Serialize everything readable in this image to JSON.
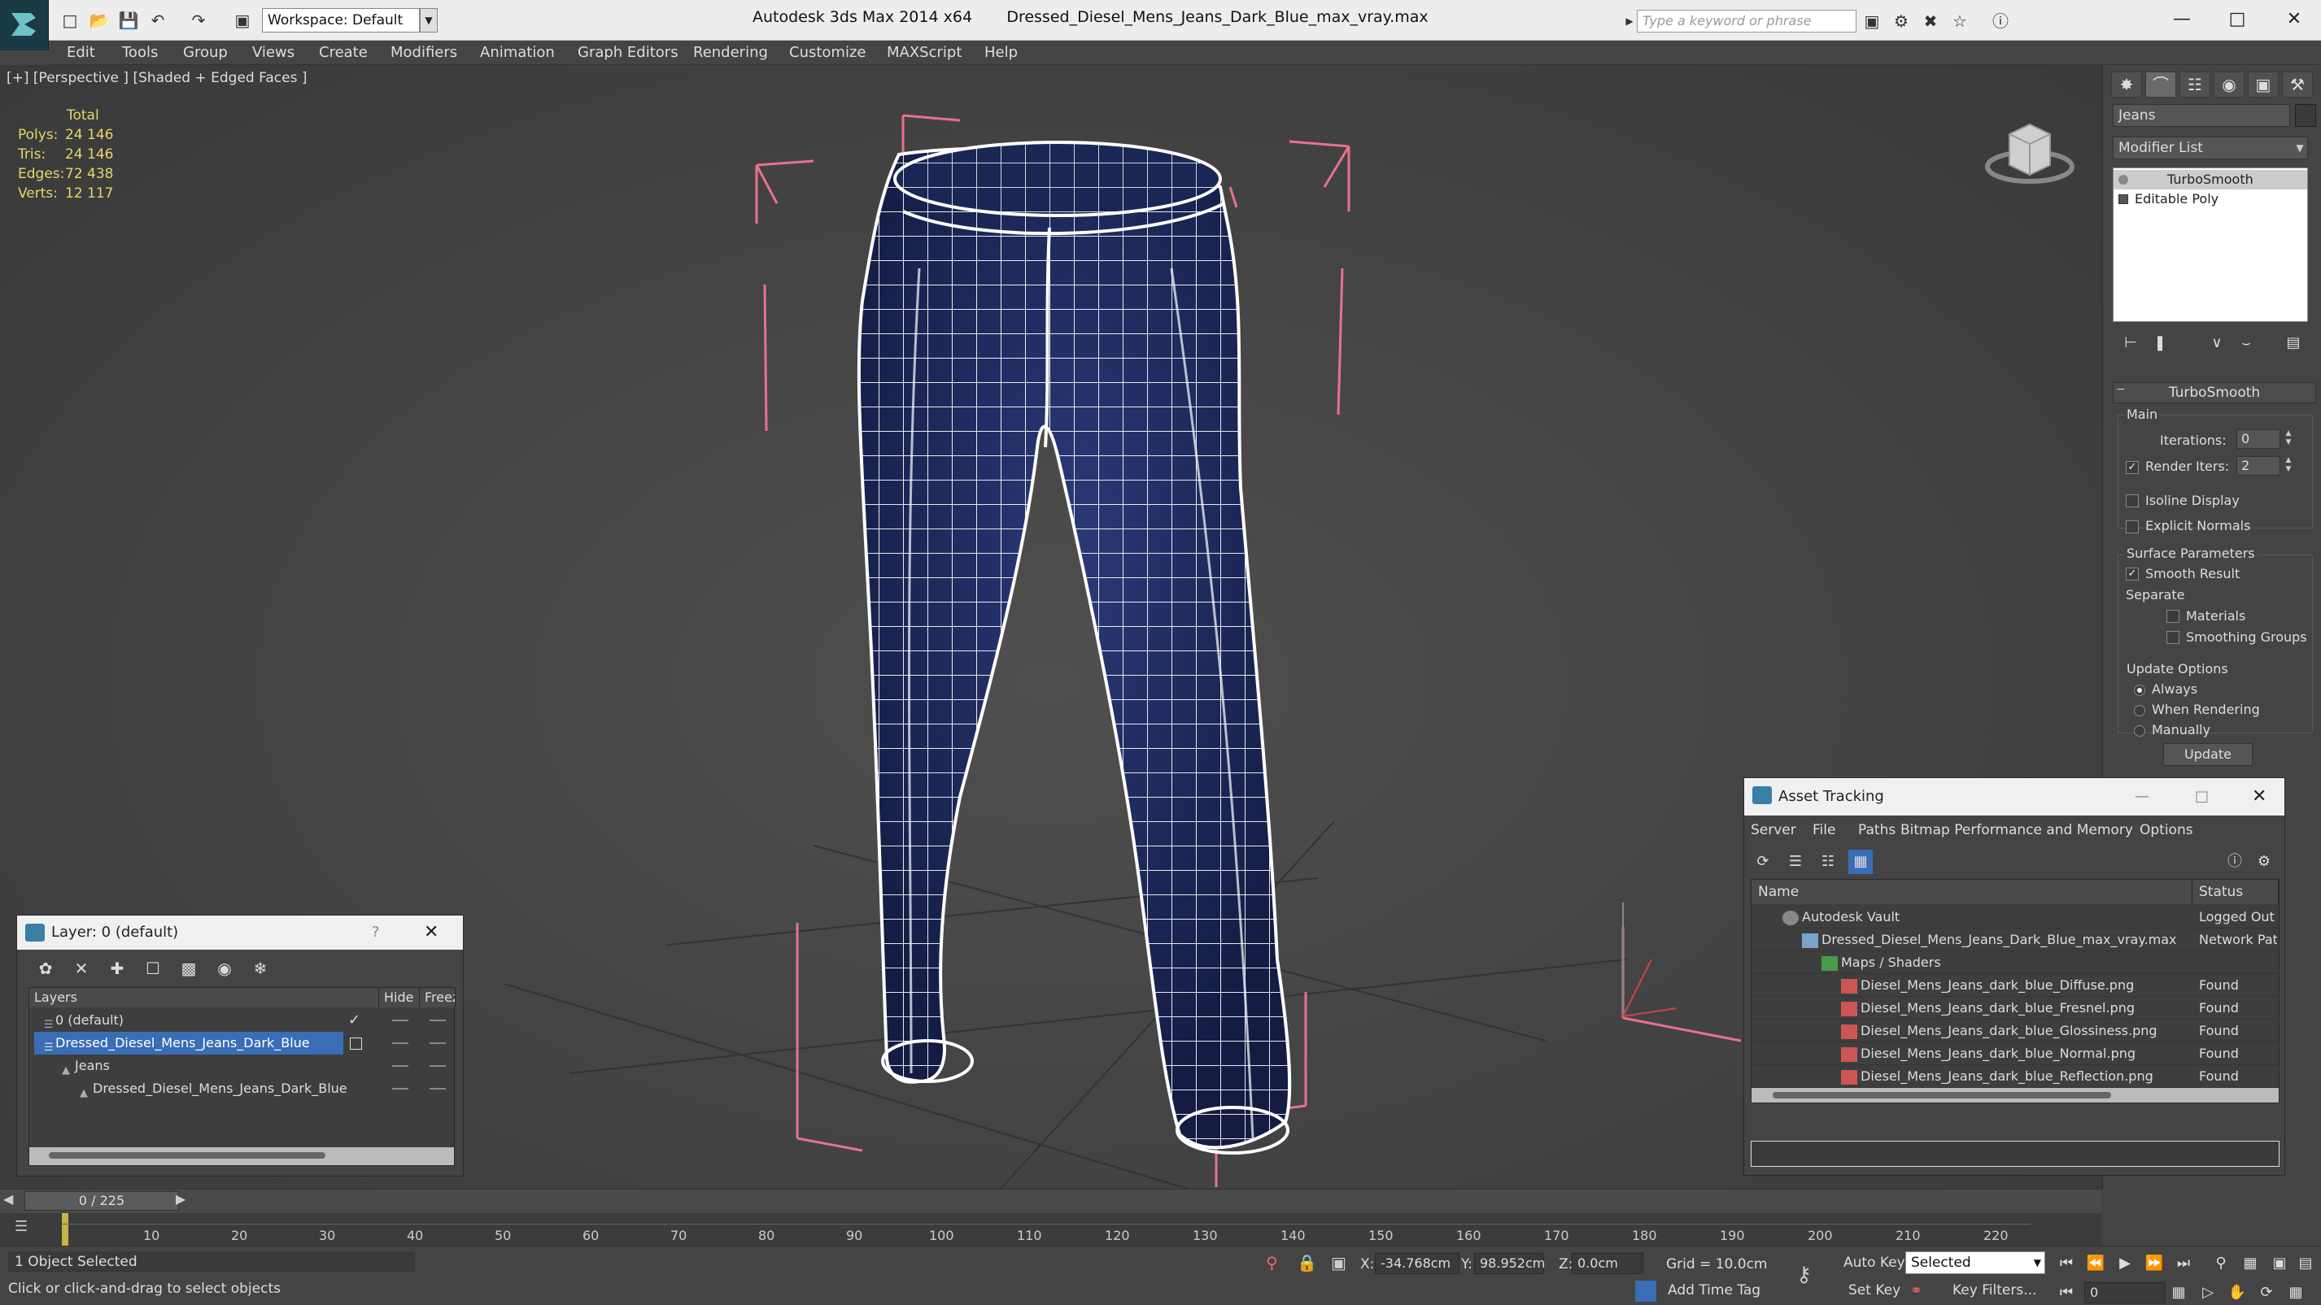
{
  "titlebar": {
    "workspace": "Workspace: Default",
    "app_name": "Autodesk 3ds Max  2014 x64",
    "file_name": "Dressed_Diesel_Mens_Jeans_Dark_Blue_max_vray.max",
    "search_placeholder": "Type a keyword or phrase"
  },
  "menu": [
    "Edit",
    "Tools",
    "Group",
    "Views",
    "Create",
    "Modifiers",
    "Animation",
    "Graph Editors",
    "Rendering",
    "Customize",
    "MAXScript",
    "Help"
  ],
  "viewport": {
    "label": "[+] [Perspective ] [Shaded + Edged Faces ]",
    "stats": {
      "total_label": "Total",
      "rows": [
        {
          "label": "Polys:",
          "value": "24 146"
        },
        {
          "label": "Tris:",
          "value": "24 146"
        },
        {
          "label": "Edges:",
          "value": "72 438"
        },
        {
          "label": "Verts:",
          "value": "12 117"
        }
      ]
    }
  },
  "command_panel": {
    "object_name": "Jeans",
    "modifier_list": "Modifier List",
    "stack": [
      "TurboSmooth",
      "Editable Poly"
    ],
    "rollout_title": "TurboSmooth",
    "main_label": "Main",
    "iterations_label": "Iterations:",
    "iterations_value": "0",
    "render_iters_label": "Render Iters:",
    "render_iters_value": "2",
    "isoline_label": "Isoline Display",
    "explicit_normals_label": "Explicit Normals",
    "surface_params_label": "Surface Parameters",
    "smooth_result_label": "Smooth Result",
    "separate_label": "Separate",
    "materials_label": "Materials",
    "smoothing_groups_label": "Smoothing Groups",
    "update_options_label": "Update Options",
    "always_label": "Always",
    "when_rendering_label": "When Rendering",
    "manually_label": "Manually",
    "update_button": "Update"
  },
  "layer_dialog": {
    "title": "Layer: 0 (default)",
    "help": "?",
    "col_layers": "Layers",
    "col_hide": "Hide",
    "col_freeze": "Freez",
    "rows": [
      {
        "name": "0 (default)",
        "indent": 0
      },
      {
        "name": "Dressed_Diesel_Mens_Jeans_Dark_Blue",
        "indent": 0
      },
      {
        "name": "Jeans",
        "indent": 1
      },
      {
        "name": "Dressed_Diesel_Mens_Jeans_Dark_Blue",
        "indent": 1
      }
    ]
  },
  "asset_tracking": {
    "title": "Asset Tracking",
    "menu": [
      "Server",
      "File",
      "Paths",
      "Bitmap Performance and Memory",
      "Options"
    ],
    "col_name": "Name",
    "col_status": "Status",
    "rows": [
      {
        "name": "Autodesk Vault",
        "status": "Logged Out",
        "indent": 1
      },
      {
        "name": "Dressed_Diesel_Mens_Jeans_Dark_Blue_max_vray.max",
        "status": "Network Pat",
        "indent": 2
      },
      {
        "name": "Maps / Shaders",
        "status": "",
        "indent": 3
      },
      {
        "name": "Diesel_Mens_Jeans_dark_blue_Diffuse.png",
        "status": "Found",
        "indent": 4
      },
      {
        "name": "Diesel_Mens_Jeans_dark_blue_Fresnel.png",
        "status": "Found",
        "indent": 4
      },
      {
        "name": "Diesel_Mens_Jeans_dark_blue_Glossiness.png",
        "status": "Found",
        "indent": 4
      },
      {
        "name": "Diesel_Mens_Jeans_dark_blue_Normal.png",
        "status": "Found",
        "indent": 4
      },
      {
        "name": "Diesel_Mens_Jeans_dark_blue_Reflection.png",
        "status": "Found",
        "indent": 4
      }
    ]
  },
  "timeline": {
    "slider": "0 / 225",
    "ticks": [
      "10",
      "20",
      "30",
      "40",
      "50",
      "60",
      "70",
      "80",
      "90",
      "100",
      "110",
      "120",
      "130",
      "140",
      "150",
      "160",
      "170",
      "180",
      "190",
      "200",
      "210",
      "220"
    ]
  },
  "statusbar": {
    "selection": "1 Object Selected",
    "prompt": "Click or click-and-drag to select objects",
    "x_label": "X:",
    "x_value": "-34.768cm",
    "y_label": "Y:",
    "y_value": "98.952cm",
    "z_label": "Z:",
    "z_value": "0.0cm",
    "grid": "Grid = 10.0cm",
    "add_time_tag": "Add Time Tag",
    "auto_key": "Auto Key",
    "selected": "Selected",
    "set_key": "Set Key",
    "key_filters": "Key Filters...",
    "frame": "0"
  },
  "colors": {
    "stats_yellow": "#e8d56a",
    "bbox_pink": "#e8728f",
    "denim": "#1a2654",
    "selection_blue": "#3a6db5"
  }
}
